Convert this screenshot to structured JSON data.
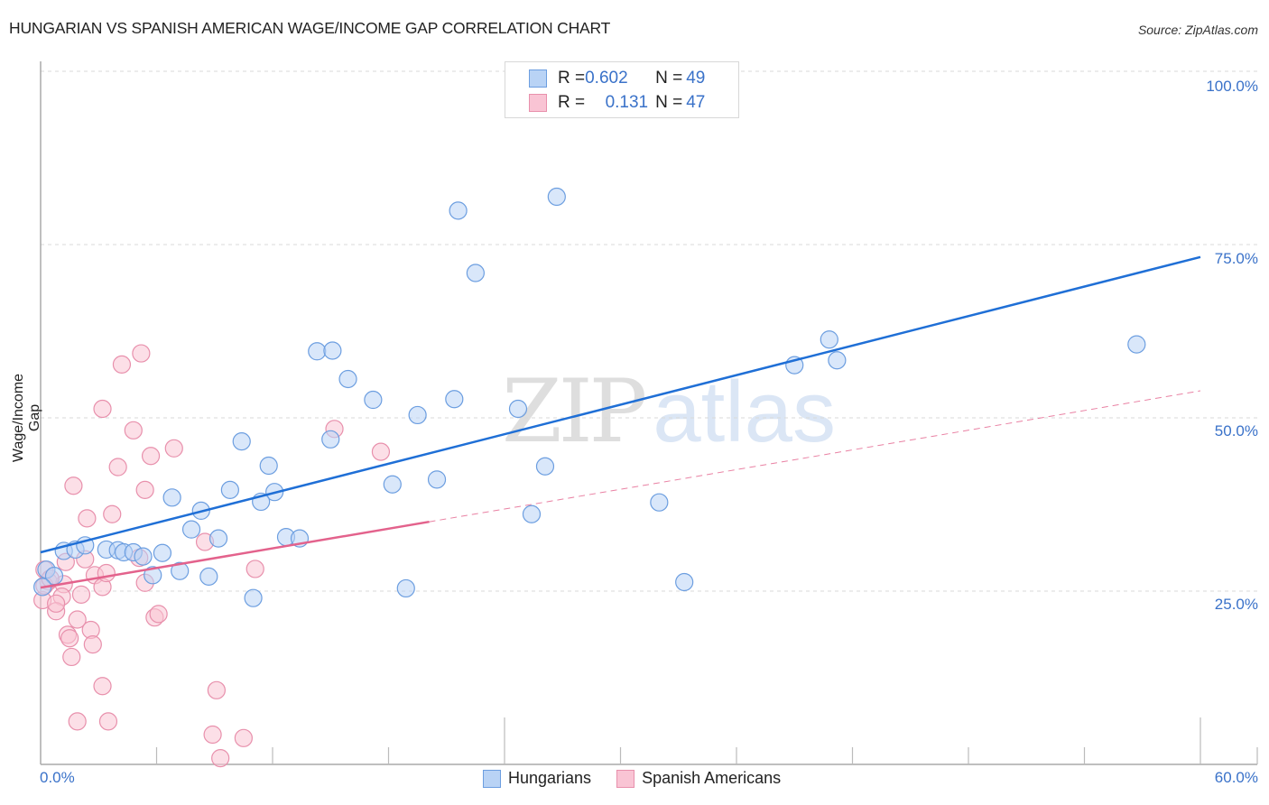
{
  "header": {
    "title": "HUNGARIAN VS SPANISH AMERICAN WAGE/INCOME GAP CORRELATION CHART",
    "source": "Source: ZipAtlas.com"
  },
  "watermark": {
    "zip": "ZIP",
    "atlas": "atlas"
  },
  "legend_top": {
    "rows": [
      {
        "r_label": "R = ",
        "r_value": "0.602",
        "n_label": "N = ",
        "n_value": "49"
      },
      {
        "r_label": "R = ",
        "r_value": "0.131",
        "n_label": "N = ",
        "n_value": "47"
      }
    ]
  },
  "legend_bottom": [
    "Hungarians",
    "Spanish Americans"
  ],
  "colors": {
    "hungarians_fill": "#b9d3f5",
    "hungarians_stroke": "#6c9ee0",
    "hungarians_line": "#1f6fd6",
    "spanish_fill": "#f9c4d4",
    "spanish_stroke": "#e890ac",
    "spanish_line": "#e3628c",
    "tick_text": "#3a72c9",
    "grid": "#d9d9d9"
  },
  "chart_data": {
    "type": "scatter",
    "title": "HUNGARIAN VS SPANISH AMERICAN WAGE/INCOME GAP CORRELATION CHART",
    "xlabel": "",
    "ylabel": "Wage/Income Gap",
    "xlim": [
      0,
      60
    ],
    "ylim": [
      0,
      100
    ],
    "x_tick_labels": [
      "0.0%",
      "60.0%"
    ],
    "y_tick_values": [
      25,
      50,
      75,
      100
    ],
    "y_tick_labels": [
      "25.0%",
      "50.0%",
      "75.0%",
      "100.0%"
    ],
    "grid": true,
    "legend_position": "bottom",
    "series": [
      {
        "name": "Hungarians",
        "r": 0.602,
        "n": 49,
        "trendline": {
          "x": [
            0,
            60
          ],
          "y": [
            30.6,
            73.2
          ],
          "style": "solid"
        },
        "points": [
          [
            21.6,
            79.9
          ],
          [
            26.7,
            81.9
          ],
          [
            22.5,
            70.9
          ],
          [
            14.3,
            59.6
          ],
          [
            15.1,
            59.7
          ],
          [
            15.9,
            55.6
          ],
          [
            17.2,
            52.6
          ],
          [
            19.5,
            50.4
          ],
          [
            21.4,
            52.7
          ],
          [
            24.7,
            51.3
          ],
          [
            10.4,
            46.6
          ],
          [
            15.0,
            46.9
          ],
          [
            11.8,
            43.1
          ],
          [
            9.8,
            39.6
          ],
          [
            12.1,
            39.3
          ],
          [
            11.4,
            37.9
          ],
          [
            6.8,
            38.5
          ],
          [
            8.3,
            36.6
          ],
          [
            7.8,
            33.9
          ],
          [
            9.2,
            32.6
          ],
          [
            12.7,
            32.8
          ],
          [
            13.4,
            32.6
          ],
          [
            18.2,
            40.4
          ],
          [
            20.5,
            41.1
          ],
          [
            26.1,
            43.0
          ],
          [
            25.4,
            36.1
          ],
          [
            32.0,
            37.8
          ],
          [
            18.9,
            25.4
          ],
          [
            11.0,
            24.0
          ],
          [
            33.3,
            26.3
          ],
          [
            1.2,
            30.8
          ],
          [
            1.8,
            31.0
          ],
          [
            2.3,
            31.6
          ],
          [
            3.4,
            31.0
          ],
          [
            4.0,
            30.9
          ],
          [
            4.3,
            30.6
          ],
          [
            4.8,
            30.6
          ],
          [
            5.3,
            30.0
          ],
          [
            6.3,
            30.5
          ],
          [
            5.8,
            27.3
          ],
          [
            7.2,
            27.9
          ],
          [
            8.7,
            27.1
          ],
          [
            40.8,
            61.3
          ],
          [
            39.0,
            57.6
          ],
          [
            41.2,
            58.3
          ],
          [
            56.7,
            60.6
          ],
          [
            0.3,
            28.1
          ],
          [
            0.7,
            27.2
          ],
          [
            0.1,
            25.6
          ]
        ]
      },
      {
        "name": "Spanish Americans",
        "r": 0.131,
        "n": 47,
        "trendline": {
          "x": [
            0,
            20.1,
            60
          ],
          "y": [
            25.5,
            35.0,
            53.9
          ],
          "style": "solid-then-dashed",
          "solid_until_x": 20.1
        },
        "points": [
          [
            4.2,
            57.7
          ],
          [
            5.2,
            59.3
          ],
          [
            3.2,
            51.3
          ],
          [
            4.8,
            48.2
          ],
          [
            6.9,
            45.6
          ],
          [
            5.7,
            44.5
          ],
          [
            4.0,
            42.9
          ],
          [
            5.4,
            39.6
          ],
          [
            1.7,
            40.2
          ],
          [
            2.4,
            35.5
          ],
          [
            3.7,
            36.1
          ],
          [
            8.5,
            32.1
          ],
          [
            11.1,
            28.2
          ],
          [
            5.1,
            29.8
          ],
          [
            5.4,
            26.2
          ],
          [
            2.8,
            27.3
          ],
          [
            3.2,
            25.6
          ],
          [
            3.4,
            27.6
          ],
          [
            2.3,
            29.6
          ],
          [
            1.3,
            29.2
          ],
          [
            1.2,
            26.0
          ],
          [
            0.4,
            26.4
          ],
          [
            0.2,
            28.1
          ],
          [
            0.1,
            23.7
          ],
          [
            1.1,
            24.2
          ],
          [
            2.1,
            24.5
          ],
          [
            0.8,
            22.1
          ],
          [
            1.9,
            20.9
          ],
          [
            2.6,
            19.4
          ],
          [
            1.4,
            18.7
          ],
          [
            2.7,
            17.3
          ],
          [
            1.5,
            18.2
          ],
          [
            1.6,
            15.5
          ],
          [
            5.9,
            21.2
          ],
          [
            6.1,
            21.7
          ],
          [
            15.2,
            48.4
          ],
          [
            17.6,
            45.1
          ],
          [
            3.2,
            11.3
          ],
          [
            9.1,
            10.7
          ],
          [
            1.9,
            6.2
          ],
          [
            3.5,
            6.2
          ],
          [
            8.9,
            4.3
          ],
          [
            10.5,
            3.8
          ],
          [
            9.3,
            0.9
          ],
          [
            0.2,
            25.8
          ],
          [
            0.5,
            26.8
          ],
          [
            0.8,
            23.2
          ]
        ]
      }
    ]
  }
}
